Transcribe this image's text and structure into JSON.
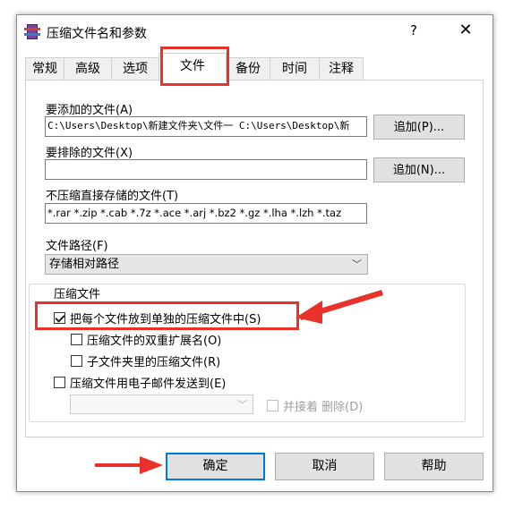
{
  "window": {
    "title": "压缩文件名和参数",
    "help": "?",
    "close": "✕"
  },
  "tabs": [
    {
      "label": "常规"
    },
    {
      "label": "高级"
    },
    {
      "label": "选项"
    },
    {
      "label": "文件",
      "active": true
    },
    {
      "label": "备份"
    },
    {
      "label": "时间"
    },
    {
      "label": "注释"
    }
  ],
  "files_to_add": {
    "label": "要添加的文件(A)",
    "value": "C:\\Users\\Desktop\\新建文件夹\\文件一  C:\\Users\\Desktop\\新",
    "button": "追加(P)..."
  },
  "files_to_exclude": {
    "label": "要排除的文件(X)",
    "value": "",
    "button": "追加(N)..."
  },
  "no_compress": {
    "label": "不压缩直接存储的文件(T)",
    "value": "*.rar *.zip *.cab *.7z *.ace *.arj *.bz2 *.gz *.lha *.lzh *.taz"
  },
  "file_path": {
    "label": "文件路径(F)",
    "selected": "存储相对路径"
  },
  "archives_group": {
    "title": "压缩文件",
    "put_each": {
      "label": "把每个文件放到单独的压缩文件中(S)",
      "checked": true
    },
    "double_ext": {
      "label": "压缩文件的双重扩展名(O)",
      "checked": false
    },
    "subfolder": {
      "label": "子文件夹里的压缩文件(R)",
      "checked": false
    },
    "email": {
      "label": "压缩文件用电子邮件发送到(E)",
      "checked": false
    },
    "email_select": "",
    "delete_after": {
      "label": "并接着 删除(D)",
      "checked": false
    }
  },
  "buttons": {
    "ok": "确定",
    "cancel": "取消",
    "help": "帮助"
  },
  "colors": {
    "highlight": "#e8322b",
    "default_button": "#0078d7"
  }
}
